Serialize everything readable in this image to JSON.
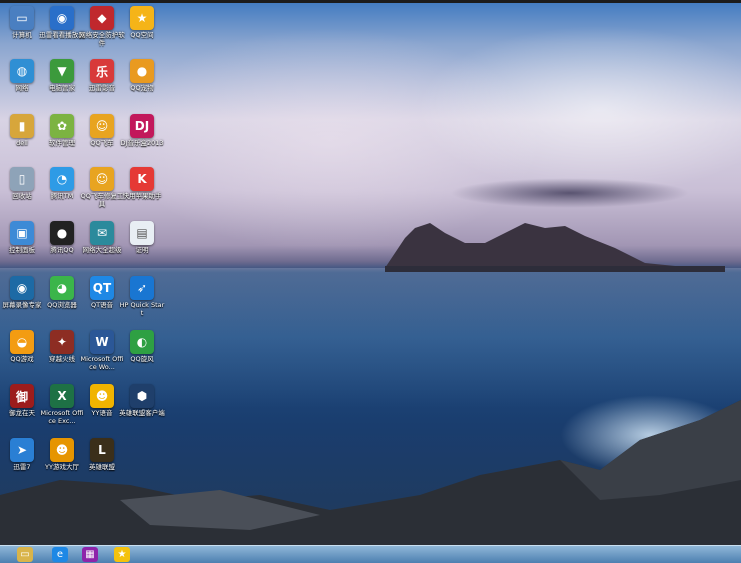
{
  "desktop_icons": [
    {
      "label": "计算机",
      "icon": "computer-icon",
      "glyph": "▭",
      "color": "#4a7fc1"
    },
    {
      "label": "迅雷看看播放器",
      "icon": "xunlei-player-icon",
      "glyph": "◉",
      "color": "#2a6fc9"
    },
    {
      "label": "网络安全防护软件",
      "icon": "security-shield-icon",
      "glyph": "◆",
      "color": "#c0282d"
    },
    {
      "label": "QQ空间",
      "icon": "qq-zone-icon",
      "glyph": "★",
      "color": "#f5b418"
    },
    {
      "label": "网络",
      "icon": "network-icon",
      "glyph": "◍",
      "color": "#2f8fd4"
    },
    {
      "label": "电脑管家",
      "icon": "pc-manager-icon",
      "glyph": "▼",
      "color": "#3c9a3c"
    },
    {
      "label": "迅雷影音",
      "icon": "video-icon",
      "glyph": "乐",
      "color": "#d83a3a"
    },
    {
      "label": "QQ宠物",
      "icon": "qq-pet-icon",
      "glyph": "●",
      "color": "#e99a20"
    },
    {
      "label": "dell",
      "icon": "folder-icon",
      "glyph": "▮",
      "color": "#d7a63b"
    },
    {
      "label": "软件管理",
      "icon": "apps-icon",
      "glyph": "✿",
      "color": "#7cb342"
    },
    {
      "label": "QQ飞车",
      "icon": "qq-speed-icon",
      "glyph": "☺",
      "color": "#e8a420"
    },
    {
      "label": "DJ音乐盒2013",
      "icon": "dj-icon",
      "glyph": "DJ",
      "color": "#c2185b"
    },
    {
      "label": "回收站",
      "icon": "recycle-bin-icon",
      "glyph": "▯",
      "color": "#8ea3b8"
    },
    {
      "label": "腾讯TM",
      "icon": "tm-icon",
      "glyph": "◔",
      "color": "#2e9be6"
    },
    {
      "label": "QQ飞车修复工具",
      "icon": "qq-speed-tool-icon",
      "glyph": "☺",
      "color": "#e8a420"
    },
    {
      "label": "快用苹果助手",
      "icon": "kuaiyong-icon",
      "glyph": "K",
      "color": "#e53935"
    },
    {
      "label": "控制面板",
      "icon": "control-panel-icon",
      "glyph": "▣",
      "color": "#3d8ad6"
    },
    {
      "label": "腾讯QQ",
      "icon": "qq-icon",
      "glyph": "●",
      "color": "#222222"
    },
    {
      "label": "网络大全超级",
      "icon": "web-icon",
      "glyph": "✉",
      "color": "#2b8a9c"
    },
    {
      "label": "证明",
      "icon": "document-icon",
      "glyph": "▤",
      "color": "#e8eef4"
    },
    {
      "label": "屏幕录像专家",
      "icon": "screen-recorder-icon",
      "glyph": "◉",
      "color": "#1d6aa5"
    },
    {
      "label": "QQ浏览器",
      "icon": "qq-browser-icon",
      "glyph": "◕",
      "color": "#3bb54a"
    },
    {
      "label": "QT语音",
      "icon": "qt-voice-icon",
      "glyph": "QT",
      "color": "#1e88e5"
    },
    {
      "label": "HP Quick Start",
      "icon": "hp-quickstart-icon",
      "glyph": "➶",
      "color": "#1976d2"
    },
    {
      "label": "QQ游戏",
      "icon": "qq-game-icon",
      "glyph": "◒",
      "color": "#f39c12"
    },
    {
      "label": "穿越火线",
      "icon": "crossfire-icon",
      "glyph": "✦",
      "color": "#8d2d23"
    },
    {
      "label": "Microsoft Office Wo...",
      "icon": "word-icon",
      "glyph": "W",
      "color": "#2b5797"
    },
    {
      "label": "QQ旋风",
      "icon": "qq-cyclone-icon",
      "glyph": "◐",
      "color": "#2ea043"
    },
    {
      "label": "御龙在天",
      "icon": "game-yulong-icon",
      "glyph": "御",
      "color": "#9c1c1c"
    },
    {
      "label": "Microsoft Office Exc...",
      "icon": "excel-icon",
      "glyph": "X",
      "color": "#1e7145"
    },
    {
      "label": "YY语音",
      "icon": "yy-voice-icon",
      "glyph": "☻",
      "color": "#f0b400"
    },
    {
      "label": "英雄联盟客户端",
      "icon": "lol-client-icon",
      "glyph": "⬢",
      "color": "#1f3f6b"
    },
    {
      "label": "迅雷7",
      "icon": "thunder-icon",
      "glyph": "➤",
      "color": "#2a7fd4"
    },
    {
      "label": "YY游戏大厅",
      "icon": "yy-game-icon",
      "glyph": "☻",
      "color": "#e69500"
    },
    {
      "label": "英雄联盟",
      "icon": "lol-icon",
      "glyph": "L",
      "color": "#3b2f1a"
    }
  ],
  "taskbar": {
    "items": [
      {
        "icon": "explorer-folder-icon",
        "glyph": "▭",
        "color": "#d9b44a"
      },
      {
        "icon": "internet-explorer-icon",
        "glyph": "e",
        "color": "#1e88e5"
      },
      {
        "icon": "media-icon",
        "glyph": "▦",
        "color": "#8e24aa"
      },
      {
        "icon": "star-app-icon",
        "glyph": "★",
        "color": "#f4c20d"
      }
    ]
  }
}
